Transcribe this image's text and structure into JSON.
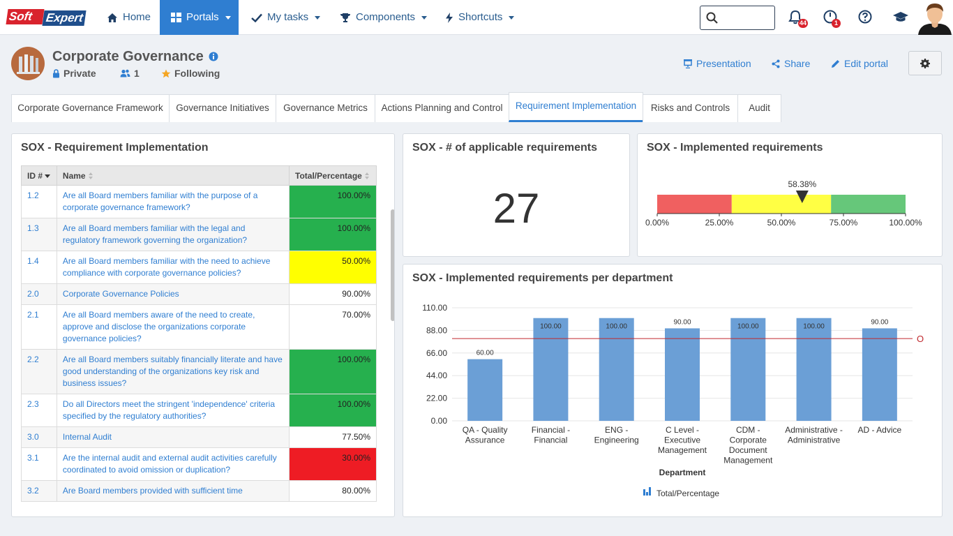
{
  "nav": {
    "logo_soft": "Soft",
    "logo_expert": "Expert",
    "items": [
      {
        "label": "Home",
        "icon": "home-icon"
      },
      {
        "label": "Portals",
        "icon": "grid-icon",
        "active": true
      },
      {
        "label": "My tasks",
        "icon": "check-icon"
      },
      {
        "label": "Components",
        "icon": "trophy-icon"
      },
      {
        "label": "Shortcuts",
        "icon": "bolt-icon"
      }
    ],
    "search_placeholder": "",
    "notifications_count": "44",
    "alerts_count": "1"
  },
  "header": {
    "title": "Corporate Governance",
    "privacy": "Private",
    "members": "1",
    "following": "Following",
    "presentation": "Presentation",
    "share": "Share",
    "edit_portal": "Edit portal"
  },
  "tabs": [
    "Corporate Governance Framework",
    "Governance Initiatives",
    "Governance Metrics",
    "Actions Planning and Control",
    "Requirement Implementation",
    "Risks and Controls",
    "Audit"
  ],
  "active_tab": 4,
  "table_panel": {
    "title": "SOX - Requirement Implementation",
    "columns": [
      "ID #",
      "Name",
      "Total/Percentage"
    ],
    "rows": [
      {
        "id": "1.2",
        "name": "Are all Board members familiar with the purpose of a corporate governance framework?",
        "pct": "100.00%",
        "color": "green"
      },
      {
        "id": "1.3",
        "name": "Are all Board members familiar with the legal and regulatory framework governing the organization?",
        "pct": "100.00%",
        "color": "green"
      },
      {
        "id": "1.4",
        "name": "Are all Board members familiar with the need to achieve compliance with corporate governance policies?",
        "pct": "50.00%",
        "color": "yellow"
      },
      {
        "id": "2.0",
        "name": "Corporate Governance Policies",
        "pct": "90.00%",
        "color": "none"
      },
      {
        "id": "2.1",
        "name": "Are all Board members aware of the need to create, approve and disclose the organizations corporate governance policies?",
        "pct": "70.00%",
        "color": "none"
      },
      {
        "id": "2.2",
        "name": "Are all Board members suitably financially literate and have good understanding of the organizations key risk and business issues?",
        "pct": "100.00%",
        "color": "green"
      },
      {
        "id": "2.3",
        "name": "Do all Directors meet the stringent 'independence' criteria specified by the regulatory authorities?",
        "pct": "100.00%",
        "color": "green"
      },
      {
        "id": "3.0",
        "name": "Internal Audit",
        "pct": "77.50%",
        "color": "none"
      },
      {
        "id": "3.1",
        "name": "Are the internal audit and external audit activities carefully coordinated to avoid omission or duplication?",
        "pct": "30.00%",
        "color": "red"
      },
      {
        "id": "3.2",
        "name": "Are Board members provided with sufficient time",
        "pct": "80.00%",
        "color": "none"
      }
    ]
  },
  "count_panel": {
    "title": "SOX - # of applicable requirements",
    "value": "27"
  },
  "gauge_panel": {
    "title": "SOX - Implemented requirements",
    "value": 58.38,
    "value_label": "58.38%",
    "ticks": [
      "0.00%",
      "25.00%",
      "50.00%",
      "75.00%",
      "100.00%"
    ],
    "bands": [
      {
        "from": 0,
        "to": 30,
        "color": "#f06060"
      },
      {
        "from": 30,
        "to": 70,
        "color": "#ffff44"
      },
      {
        "from": 70,
        "to": 100,
        "color": "#66c77a"
      }
    ]
  },
  "chart_panel": {
    "title": "SOX - Implemented requirements per department"
  },
  "chart_data": {
    "type": "bar",
    "title": "SOX - Implemented requirements per department",
    "xlabel": "Department",
    "ylabel": "",
    "categories": [
      [
        "QA - Quality",
        "Assurance"
      ],
      [
        "Financial -",
        "Financial"
      ],
      [
        "ENG -",
        "Engineering"
      ],
      [
        "C Level -",
        "Executive",
        "Management"
      ],
      [
        "CDM -",
        "Corporate",
        "Document",
        "Management"
      ],
      [
        "Administrative -",
        "Administrative"
      ],
      [
        "AD - Advice"
      ]
    ],
    "series": [
      {
        "name": "Total/Percentage",
        "values": [
          60.0,
          100.0,
          100.0,
          90.0,
          100.0,
          100.0,
          90.0
        ],
        "color": "#6b9fd6"
      }
    ],
    "data_labels": [
      "60.00",
      "100.00",
      "100.00",
      "90.00",
      "100.00",
      "100.00",
      "90.00"
    ],
    "yticks": [
      "0.00",
      "22.00",
      "44.00",
      "66.00",
      "88.00",
      "110.00"
    ],
    "ylim": [
      0,
      110
    ],
    "target_line": {
      "value": 80,
      "label": "O",
      "color": "#c0282d"
    },
    "legend": "bottom",
    "grid": true
  }
}
